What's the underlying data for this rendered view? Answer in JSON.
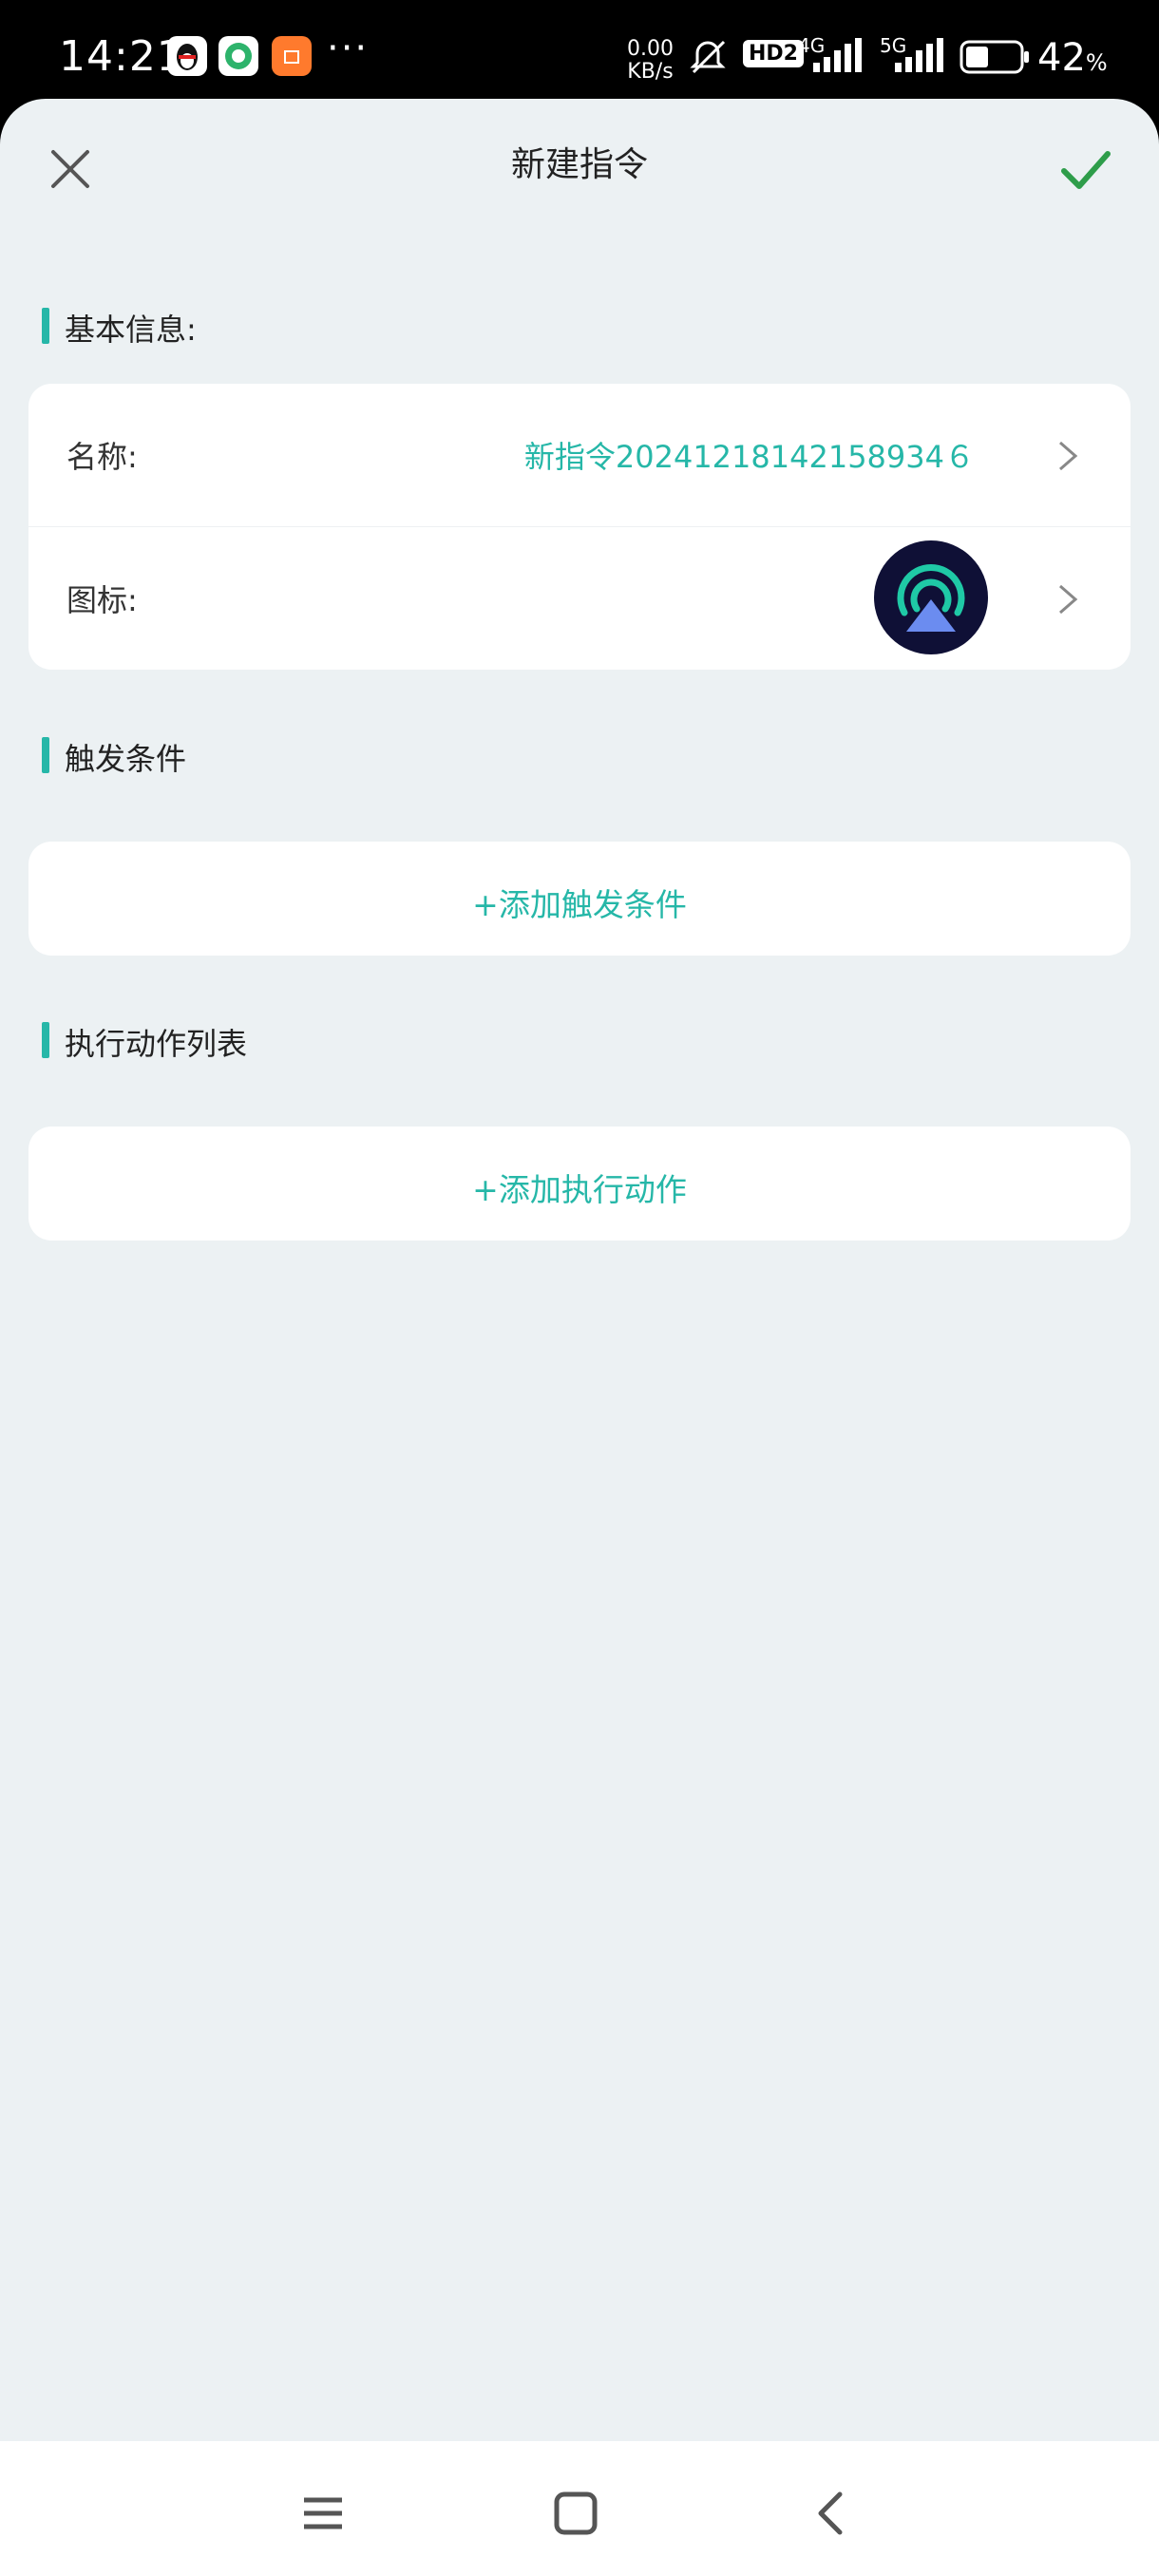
{
  "status_bar": {
    "time": "14:21",
    "more": "···",
    "speed_value": "0.00",
    "speed_unit": "KB/s",
    "hd": "HD2",
    "net1": "4G",
    "net2": "5G",
    "battery_value": "42",
    "battery_unit": "%",
    "battery_level": 0.42
  },
  "header": {
    "title": "新建指令",
    "close_icon": "close-icon",
    "confirm_icon": "check-icon"
  },
  "basic_info": {
    "label": "基本信息:",
    "name_label": "名称:",
    "name_value": "新指令20241218142158934６",
    "icon_label": "图标:"
  },
  "trigger": {
    "label": "触发条件",
    "add_label": "+添加触发条件"
  },
  "actions": {
    "label": "执行动作列表",
    "add_label": "+添加执行动作"
  },
  "colors": {
    "accent": "#26b7a8",
    "confirm": "#2e9d4a",
    "background": "#ecf1f3"
  }
}
